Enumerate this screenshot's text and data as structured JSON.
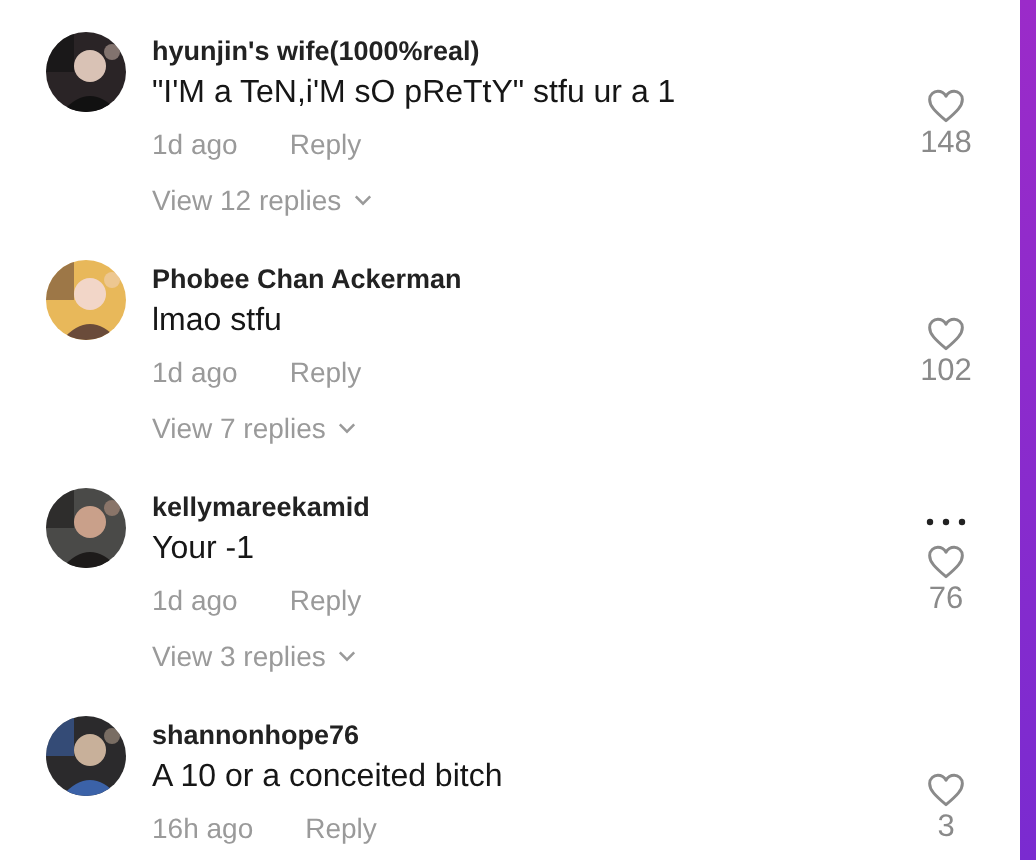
{
  "comments": [
    {
      "username": "hyunjin's wife(1000%real)",
      "text": "\"I'M a TeN,i'M sO pReTtY\" stfu ur a 1",
      "time": "1d ago",
      "reply": "Reply",
      "likes": "148",
      "more_menu": false,
      "view_replies": "View 12 replies"
    },
    {
      "username": "Phobee Chan Ackerman",
      "text": "lmao stfu",
      "time": "1d ago",
      "reply": "Reply",
      "likes": "102",
      "more_menu": false,
      "view_replies": "View 7 replies"
    },
    {
      "username": "kellymareekamid",
      "text": "Your -1",
      "time": "1d ago",
      "reply": "Reply",
      "likes": "76",
      "more_menu": true,
      "view_replies": "View 3 replies"
    },
    {
      "username": "shannonhope76",
      "text": "A 10 or a conceited bitch",
      "time": "16h ago",
      "reply": "Reply",
      "likes": "3",
      "more_menu": false
    }
  ]
}
